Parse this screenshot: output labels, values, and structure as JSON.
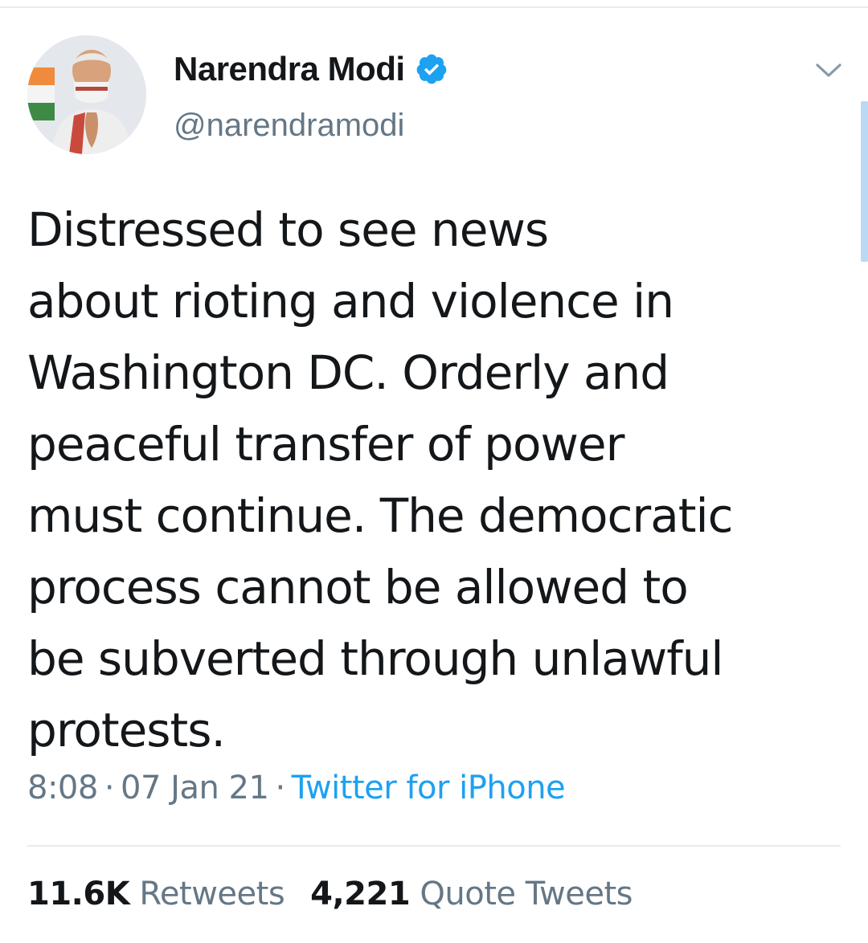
{
  "colors": {
    "text_primary": "#14171a",
    "text_secondary": "#657786",
    "link": "#1da1f2",
    "divider": "#e6ecf0",
    "verified_badge": "#1da1f2"
  },
  "author": {
    "display_name": "Narendra Modi",
    "handle": "@narendramodi",
    "verified": true,
    "avatar_icon": "profile-photo-avatar",
    "verified_icon": "verified-badge-icon"
  },
  "menu": {
    "icon": "chevron-down-icon"
  },
  "tweet": {
    "lines": [
      "Distressed to see news",
      "about rioting and violence in",
      "Washington DC. Orderly and",
      "peaceful transfer of power",
      "must continue. The democratic",
      "process cannot be allowed to",
      "be subverted through unlawful",
      "protests."
    ],
    "time": "8:08",
    "date": "07 Jan 21",
    "separator": "·",
    "source": "Twitter for iPhone"
  },
  "stats": {
    "retweets_count": "11.6K",
    "retweets_label": "Retweets",
    "quotes_count": "4,221",
    "quotes_label": "Quote Tweets"
  }
}
